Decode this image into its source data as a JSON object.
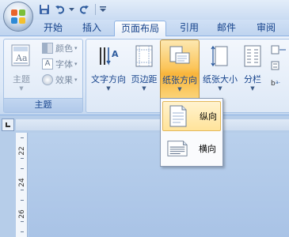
{
  "ribbon_tabs": [
    "开始",
    "插入",
    "页面布局",
    "引用",
    "邮件",
    "审阅"
  ],
  "active_tab": "页面布局",
  "theme_group": {
    "label": "主题",
    "main_button": "主题",
    "small_buttons": [
      "颜色",
      "字体",
      "效果"
    ]
  },
  "page_setup": {
    "buttons": [
      "文字方向",
      "页边距",
      "纸张方向",
      "纸张大小",
      "分栏"
    ]
  },
  "orientation_menu": {
    "items": [
      "纵向",
      "横向"
    ],
    "selected": "纵向"
  },
  "vertical_ruler": [
    "22",
    "24",
    "26"
  ],
  "colors": {
    "tab_text": "#15428b",
    "highlight": "#f9b43b"
  }
}
